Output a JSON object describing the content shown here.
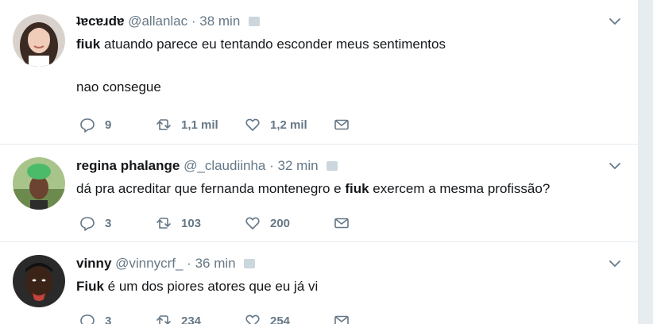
{
  "tweets": [
    {
      "name": "ʇɐcɐɹdɐ",
      "handle": "@allanlac",
      "separator": "·",
      "time": "38 min",
      "text_bold": "fiuk",
      "text_rest": " atuando parece eu tentando esconder meus sentimentos",
      "text_line2": "nao consegue",
      "replies": "9",
      "retweets": "1,1 mil",
      "likes": "1,2 mil"
    },
    {
      "name": "regina phalange",
      "handle": "@_claudiinha",
      "separator": "·",
      "time": "32 min",
      "text_pre": "dá pra acreditar que fernanda montenegro e ",
      "text_bold": "fiuk",
      "text_post": " exercem a mesma profissão?",
      "replies": "3",
      "retweets": "103",
      "likes": "200"
    },
    {
      "name": "vinny",
      "handle": "@vinnycrf_",
      "separator": "·",
      "time": "36 min",
      "text_bold": "Fiuk",
      "text_rest": " é um dos piores atores que eu já vi",
      "replies": "3",
      "retweets": "234",
      "likes": "254"
    }
  ],
  "colors": {
    "background": "#e6ecf0",
    "card": "#ffffff",
    "text": "#14171a",
    "muted": "#657786"
  },
  "icons": [
    "reply-icon",
    "retweet-icon",
    "like-icon",
    "message-icon",
    "chevron-down-icon",
    "verified-placeholder-icon"
  ]
}
